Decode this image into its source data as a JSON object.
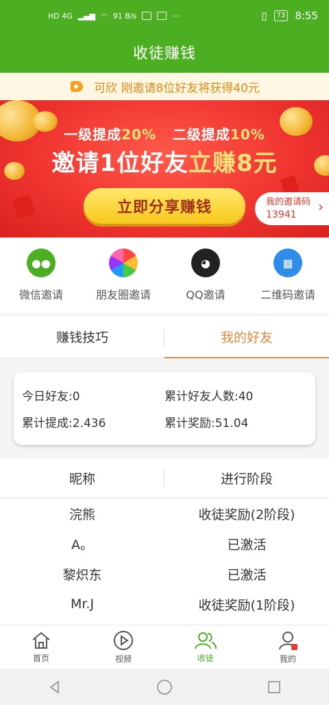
{
  "status_bar": {
    "network": "HD 4G",
    "speed": "91 B/s",
    "battery": "73",
    "time": "8:55"
  },
  "title": "收徒赚钱",
  "notice": "可欣 刚邀请8位好友将获得40元",
  "banner": {
    "line1_a": "一级提成",
    "line1_a_val": "20%",
    "line1_b": "二级提成",
    "line1_b_val": "10%",
    "line2_a": "邀请1位好友",
    "line2_b": "立赚8元",
    "share_button": "立即分享赚钱",
    "invite_code_label": "我的邀请码",
    "invite_code": "13941"
  },
  "share_options": [
    {
      "label": "微信邀请",
      "icon": "wechat-icon"
    },
    {
      "label": "朋友圈邀请",
      "icon": "moments-icon"
    },
    {
      "label": "QQ邀请",
      "icon": "qq-icon"
    },
    {
      "label": "二维码邀请",
      "icon": "qrcode-icon"
    }
  ],
  "tabs": [
    "赚钱技巧",
    "我的好友"
  ],
  "active_tab": "我的好友",
  "stats": {
    "today_friends": "今日好友:0",
    "total_friends": "累计好友人数:40",
    "total_commission": "累计提成:2.436",
    "total_reward": "累计奖励:51.04"
  },
  "friends_table": {
    "headers": [
      "昵称",
      "进行阶段"
    ],
    "rows": [
      [
        "浣熊",
        "收徒奖励(2阶段)"
      ],
      [
        "A。",
        "已激活"
      ],
      [
        "黎炽东",
        "已激活"
      ],
      [
        "Mr.J",
        "收徒奖励(1阶段)"
      ]
    ]
  },
  "bottom_nav": [
    {
      "label": "首页",
      "icon": "home-icon"
    },
    {
      "label": "视频",
      "icon": "video-icon"
    },
    {
      "label": "收徒",
      "icon": "friends-icon"
    },
    {
      "label": "我的",
      "icon": "profile-icon"
    }
  ],
  "colors": {
    "brand_green": "#4caf22",
    "accent_orange": "#e0893e",
    "banner_red": "#f03530",
    "highlight_yellow": "#ffe37a"
  }
}
